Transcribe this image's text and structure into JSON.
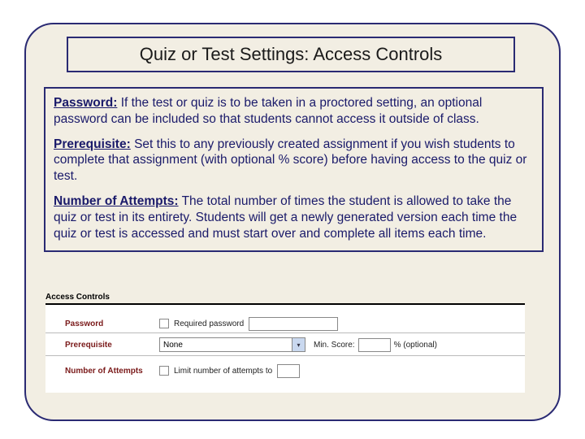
{
  "title": "Quiz or Test Settings: Access Controls",
  "section_header": "Access Controls",
  "descriptions": {
    "password": {
      "label": "Password:",
      "text": "  If the test or quiz is to be taken in a proctored setting, an optional password can be included so that students cannot access it outside of class."
    },
    "prerequisite": {
      "label": "Prerequisite:",
      "text": "  Set this to any previously created assignment if you wish students to complete that assignment (with optional % score) before having access to the quiz or test."
    },
    "attempts": {
      "label": "Number of Attempts:",
      "text": "  The total number of times the student is allowed to take the quiz or test in its entirety.  Students will get a newly generated version each time the quiz or test is accessed and must start over and complete all items each time."
    }
  },
  "form": {
    "password_label": "Password",
    "password_checkbox_label": "Required password",
    "prerequisite_label": "Prerequisite",
    "prerequisite_select_value": "None",
    "min_score_label": "Min. Score:",
    "min_score_suffix": "% (optional)",
    "attempts_label": "Number of Attempts",
    "attempts_checkbox_label": "Limit number of attempts to"
  }
}
